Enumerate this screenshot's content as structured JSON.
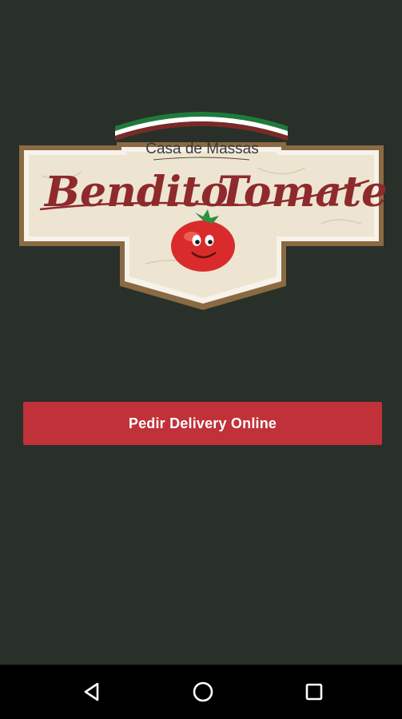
{
  "logo": {
    "subtitle": "Casa de Massas",
    "name_part1": "Bendito",
    "name_part2": "Tomate"
  },
  "main": {
    "cta_label": "Pedir Delivery Online"
  },
  "colors": {
    "background": "#283029",
    "cta_button": "#c0313a",
    "nav_bar": "#000000",
    "banner_green": "#1f7a3c",
    "banner_red": "#c0313a",
    "frame_brown": "#8a6a43",
    "parchment": "#f1ebdd",
    "tomato": "#d92b2b"
  },
  "nav": {
    "back_icon": "back-triangle-icon",
    "home_icon": "home-circle-icon",
    "recents_icon": "recents-square-icon"
  }
}
